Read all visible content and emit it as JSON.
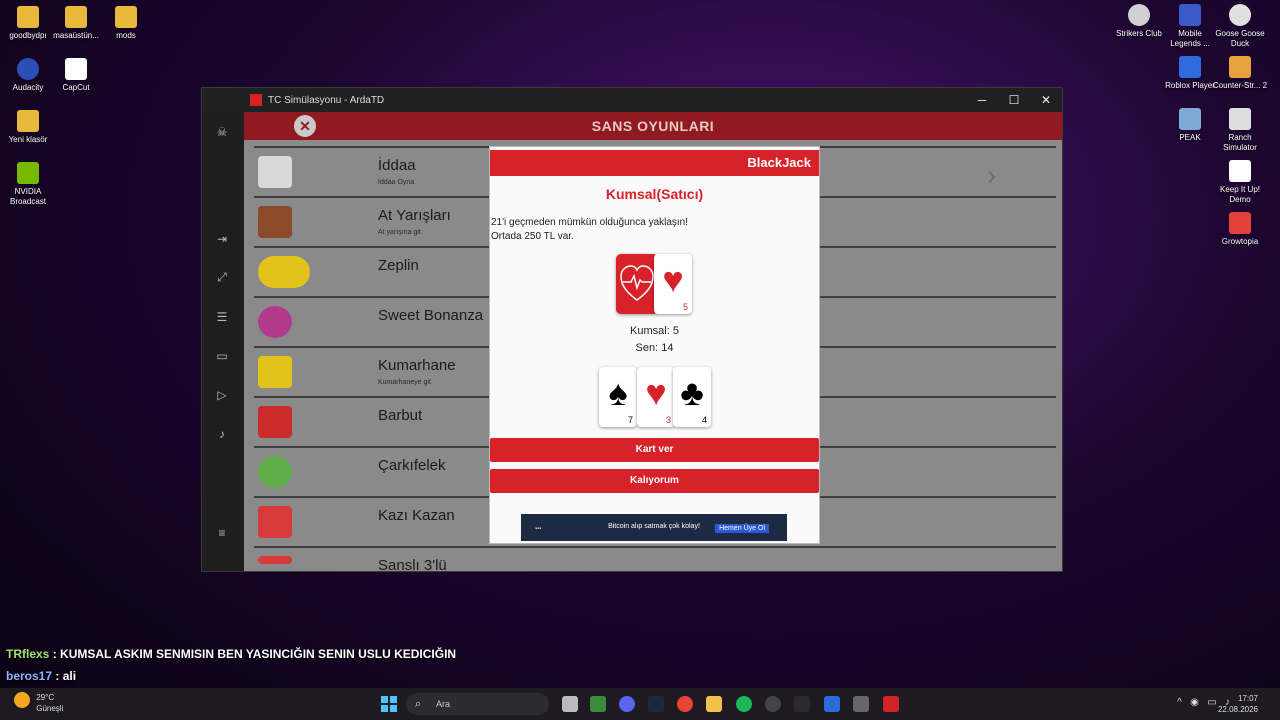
{
  "desktop": {
    "left_icons": [
      {
        "label": "goodbydpı",
        "color": "#e8b93a"
      },
      {
        "label": "masaüstün...",
        "color": "#e8b93a"
      },
      {
        "label": "mods",
        "color": "#e8b93a"
      },
      {
        "label": "Audacity",
        "color": "#2a4fb8"
      },
      {
        "label": "CapCut",
        "color": "#111111"
      },
      {
        "label": "Yeni klasör",
        "color": "#e8b93a"
      },
      {
        "label": "NVIDIA Broadcast",
        "color": "#76b900"
      }
    ],
    "right_icons": [
      {
        "label": "Strikers Club",
        "color": "#d0d0d0"
      },
      {
        "label": "Mobile Legends ...",
        "color": "#3a5ac8"
      },
      {
        "label": "Goose Goose Duck",
        "color": "#e0e0e0"
      },
      {
        "label": "Roblox Player",
        "color": "#2f6bdc"
      },
      {
        "label": "Counter-Str... 2",
        "color": "#e6a23c"
      },
      {
        "label": "PEAK",
        "color": "#7fa9d6"
      },
      {
        "label": "Ranch Simulator",
        "color": "#dddddd"
      },
      {
        "label": "Keep It Up! Demo",
        "color": "#ffffff"
      },
      {
        "label": "Growtopia",
        "color": "#e0433a"
      }
    ]
  },
  "window": {
    "title": "TC Simülasyonu - ArdaTD",
    "controls": {
      "minimize": "─",
      "maximize": "☐",
      "close": "✕"
    },
    "page_title": "SANS OYUNLARI",
    "close_symbol": "✕",
    "chevron": "›",
    "games": [
      {
        "name": "İddaa",
        "sub": "İddaa Oyna",
        "color": "#d9d9d9"
      },
      {
        "name": "At Yarışları",
        "sub": "At yarışına git",
        "color": "#8b4a2a"
      },
      {
        "name": "Zeplin",
        "sub": "",
        "color": "#e3c21a"
      },
      {
        "name": "Sweet Bonanza",
        "sub": "",
        "color": "#b23a8a"
      },
      {
        "name": "Kumarhane",
        "sub": "Kumarhaneye git",
        "color": "#e3c21a"
      },
      {
        "name": "Barbut",
        "sub": "",
        "color": "#cc2b2b"
      },
      {
        "name": "Çarkıfelek",
        "sub": "",
        "color": "#5fae4a"
      },
      {
        "name": "Kazı Kazan",
        "sub": "",
        "color": "#d63a3a"
      },
      {
        "name": "Sanslı 3'lü",
        "sub": "",
        "color": "#d63a3a"
      }
    ]
  },
  "modal": {
    "header": "BlackJack",
    "dealer_title": "Kumsal(Satıcı)",
    "info_line1": "21'i geçmeden mümkün olduğunca yaklaşın!",
    "info_line2": "Ortada 250 TL var.",
    "dealer_cards": [
      {
        "suit": "♥",
        "value": "5",
        "color": "#d8222a"
      }
    ],
    "dealer_score": "Kumsal: 5",
    "player_score": "Sen: 14",
    "player_cards": [
      {
        "suit": "♠",
        "value": "7",
        "color": "#000000"
      },
      {
        "suit": "♥",
        "value": "3",
        "color": "#d8222a"
      },
      {
        "suit": "♣",
        "value": "4",
        "color": "#000000"
      }
    ],
    "hit_button": "Kart ver",
    "stand_button": "Kalıyorum",
    "ad": {
      "text": "Bitcoin alıp satmak çok kolay!",
      "button": "Hemen Üye Ol"
    }
  },
  "chat": [
    {
      "user": "TRflexs",
      "message": " : KUMSAL ASKIM SENMISIN BEN YASINCIĞIN SENIN USLU KEDICIĞIN"
    },
    {
      "user": "beros17",
      "message": " : ali"
    }
  ],
  "taskbar": {
    "temperature": "29°C",
    "weather": "Güneşli",
    "search_placeholder": "Ara",
    "time": "17:07",
    "date": "22.08.2026"
  }
}
